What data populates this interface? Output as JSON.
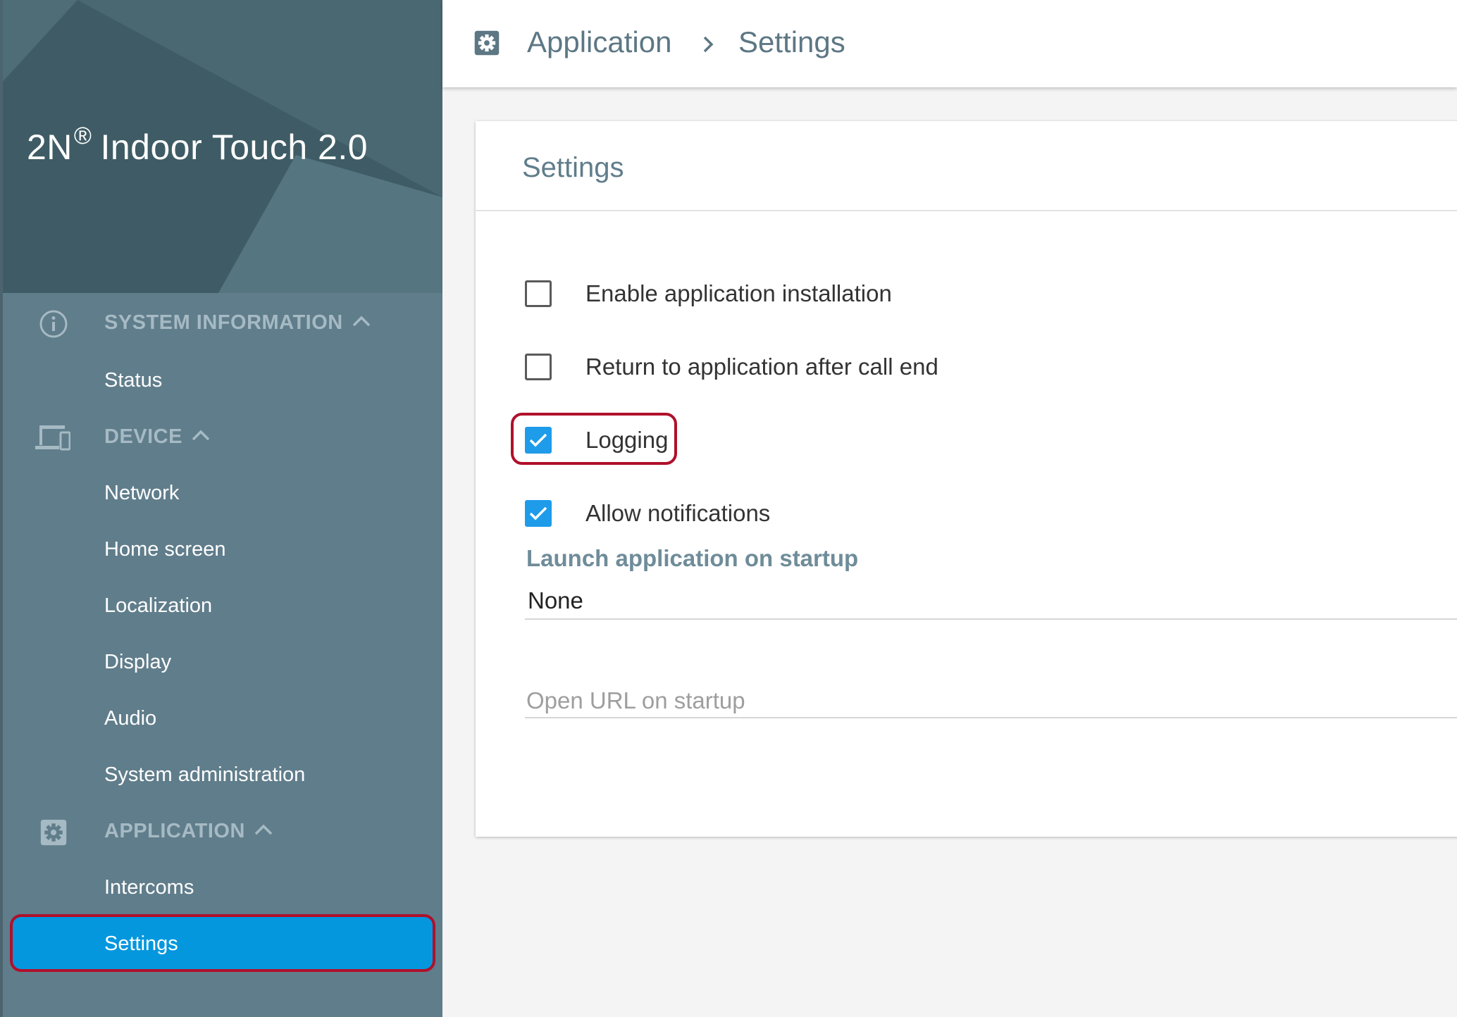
{
  "brand": {
    "name": "2N",
    "registered": "®",
    "product": "Indoor Touch 2.0"
  },
  "sidebar": {
    "sections": [
      {
        "label": "SYSTEM INFORMATION",
        "icon": "info-icon",
        "items": [
          "Status"
        ]
      },
      {
        "label": "DEVICE",
        "icon": "devices-icon",
        "items": [
          "Network",
          "Home screen",
          "Localization",
          "Display",
          "Audio",
          "System administration"
        ]
      },
      {
        "label": "APPLICATION",
        "icon": "gear-icon",
        "items": [
          "Intercoms",
          "Settings"
        ]
      }
    ],
    "active_item": "Settings"
  },
  "header": {
    "crumb1": "Application",
    "crumb2": "Settings",
    "icon": "gear-icon"
  },
  "card": {
    "title": "Settings",
    "options": [
      {
        "label": "Enable application installation",
        "checked": false
      },
      {
        "label": "Return to application after call end",
        "checked": false
      },
      {
        "label": "Logging",
        "checked": true
      },
      {
        "label": "Allow notifications",
        "checked": true
      }
    ],
    "launch_label": "Launch application on startup",
    "launch_value": "None",
    "url_placeholder": "Open URL on startup"
  },
  "colors": {
    "sidebar": "#607d8b",
    "brand_bg": "#3f5c66",
    "accent": "#0497de",
    "checkbox": "#1e9be9",
    "highlight": "#b0102a"
  }
}
